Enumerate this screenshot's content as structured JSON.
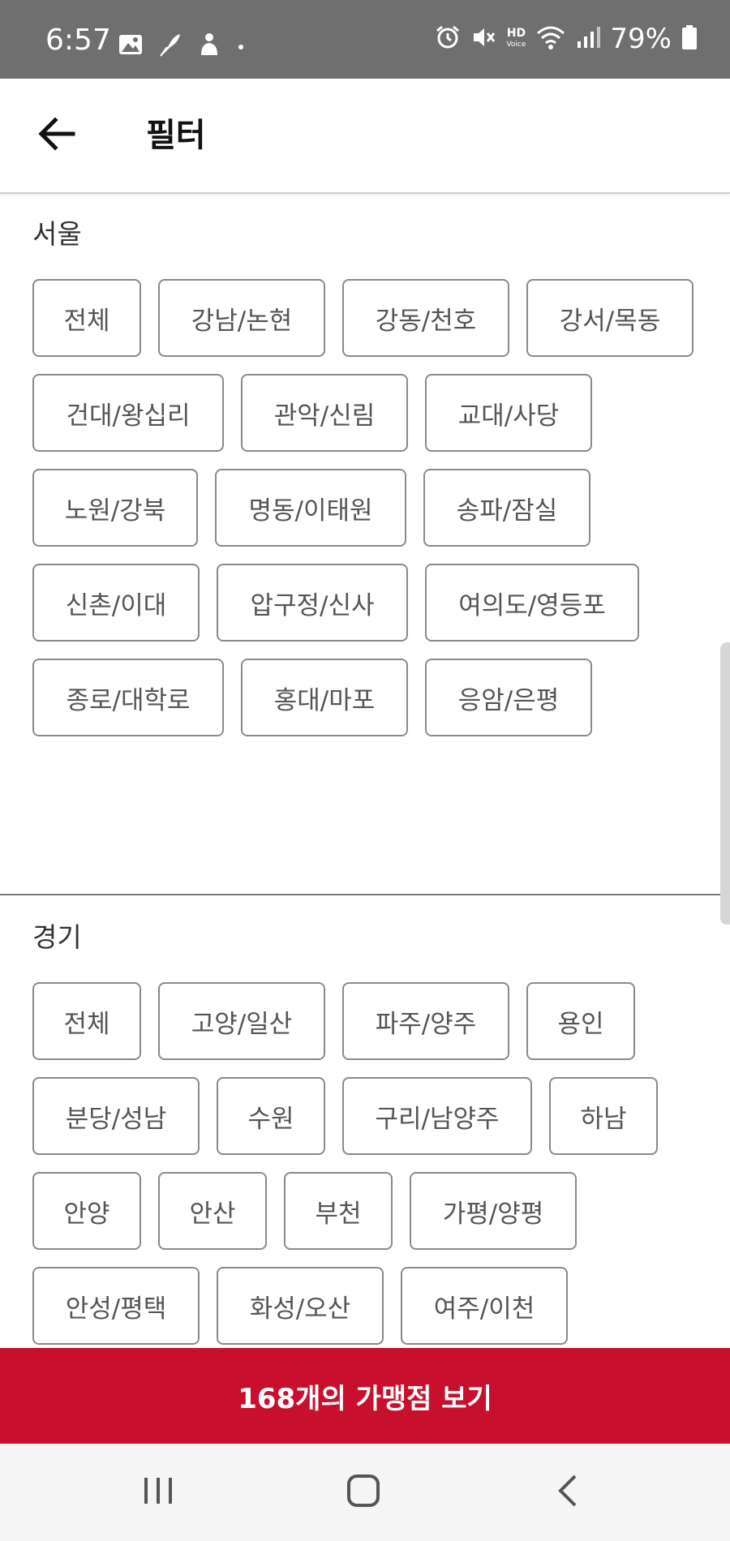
{
  "status_bar": {
    "time": "6:57",
    "battery_percent": "79%",
    "icons": [
      "image-icon",
      "feather-icon",
      "person-icon",
      "dot-icon",
      "alarm-icon",
      "mute-icon",
      "hd-voice-icon",
      "wifi-icon",
      "signal-icon",
      "battery-icon"
    ],
    "hd_text": "HD",
    "voice_text": "Voice"
  },
  "app_bar": {
    "back_icon": "arrow-left-icon",
    "title": "필터"
  },
  "seoul": {
    "title": "서울",
    "chips": [
      "전체",
      "강남/논현",
      "강동/천호",
      "강서/목동",
      "건대/왕십리",
      "관악/신림",
      "교대/사당",
      "노원/강북",
      "명동/이태원",
      "송파/잠실",
      "신촌/이대",
      "압구정/신사",
      "여의도/영등포",
      "종로/대학로",
      "홍대/마포",
      "응암/은평"
    ]
  },
  "gyeonggi": {
    "title": "경기",
    "chips": [
      "전체",
      "고양/일산",
      "파주/양주",
      "용인",
      "분당/성남",
      "수원",
      "구리/남양주",
      "하남",
      "안양",
      "안산",
      "부천",
      "가평/양평",
      "안성/평택",
      "화성/오산",
      "여주/이천"
    ]
  },
  "cta": {
    "label": "168개의 가맹점 보기"
  },
  "nav_bar": {
    "icons": [
      "recent-apps-icon",
      "home-icon",
      "back-icon"
    ]
  },
  "colors": {
    "accent": "#c8102e",
    "status_bar": "#6f6f6f",
    "chip_border": "#8a8a8a"
  }
}
